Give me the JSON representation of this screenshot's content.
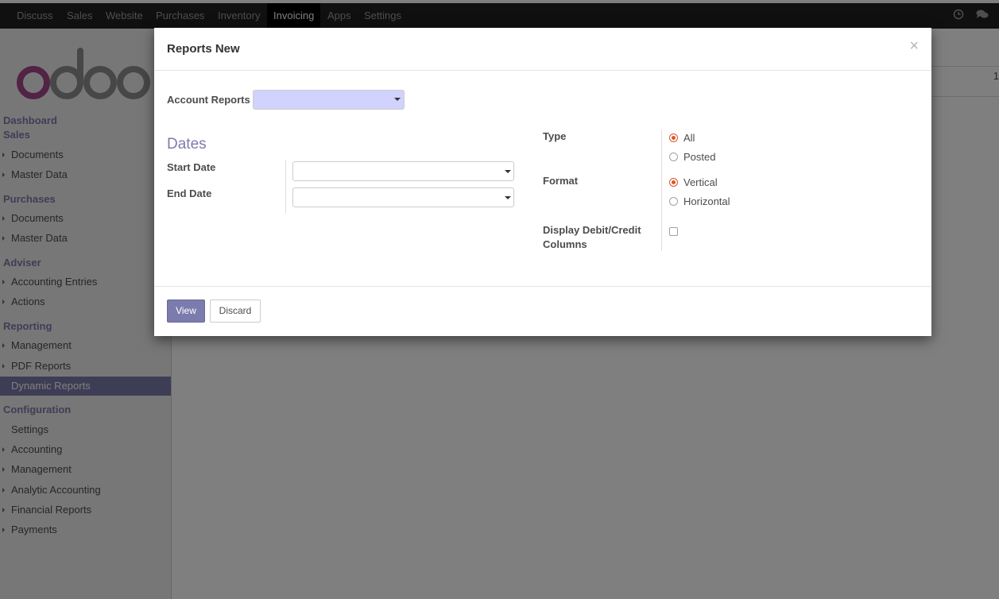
{
  "navbar": {
    "items": [
      "Discuss",
      "Sales",
      "Website",
      "Purchases",
      "Inventory",
      "Invoicing",
      "Apps",
      "Settings"
    ],
    "active": "Invoicing",
    "icons": [
      "clock-icon",
      "chat-icon"
    ]
  },
  "sidebar": {
    "logo_icon": "odoo-logo",
    "sections": [
      {
        "title": "Dashboard"
      },
      {
        "title": "Sales",
        "items": [
          "Documents",
          "Master Data"
        ]
      },
      {
        "title": "Purchases",
        "items": [
          "Documents",
          "Master Data"
        ]
      },
      {
        "title": "Adviser",
        "items": [
          "Accounting Entries",
          "Actions"
        ]
      },
      {
        "title": "Reporting",
        "items": [
          "Management",
          "PDF Reports",
          "Dynamic Reports"
        ]
      },
      {
        "title": "Configuration",
        "items": [
          "Settings",
          "Accounting",
          "Management",
          "Analytic Accounting",
          "Financial Reports",
          "Payments"
        ]
      }
    ],
    "selected": "Dynamic Reports"
  },
  "background": {
    "number": "1"
  },
  "modal": {
    "title": "Reports New",
    "close": "×",
    "account_reports_label": "Account Reports",
    "account_reports_value": "",
    "dates_title": "Dates",
    "start_date_label": "Start Date",
    "start_date_value": "",
    "end_date_label": "End Date",
    "end_date_value": "",
    "type_label": "Type",
    "type_options": [
      "All",
      "Posted"
    ],
    "type_selected": "All",
    "format_label": "Format",
    "format_options": [
      "Vertical",
      "Horizontal"
    ],
    "format_selected": "Vertical",
    "debit_credit_label_1": "Display Debit/Credit",
    "debit_credit_label_2": "Columns",
    "debit_credit_checked": false,
    "view_button": "View",
    "discard_button": "Discard"
  },
  "colors": {
    "accent": "#7c7bad",
    "radio": "#d9572a",
    "navbar": "#212121"
  }
}
